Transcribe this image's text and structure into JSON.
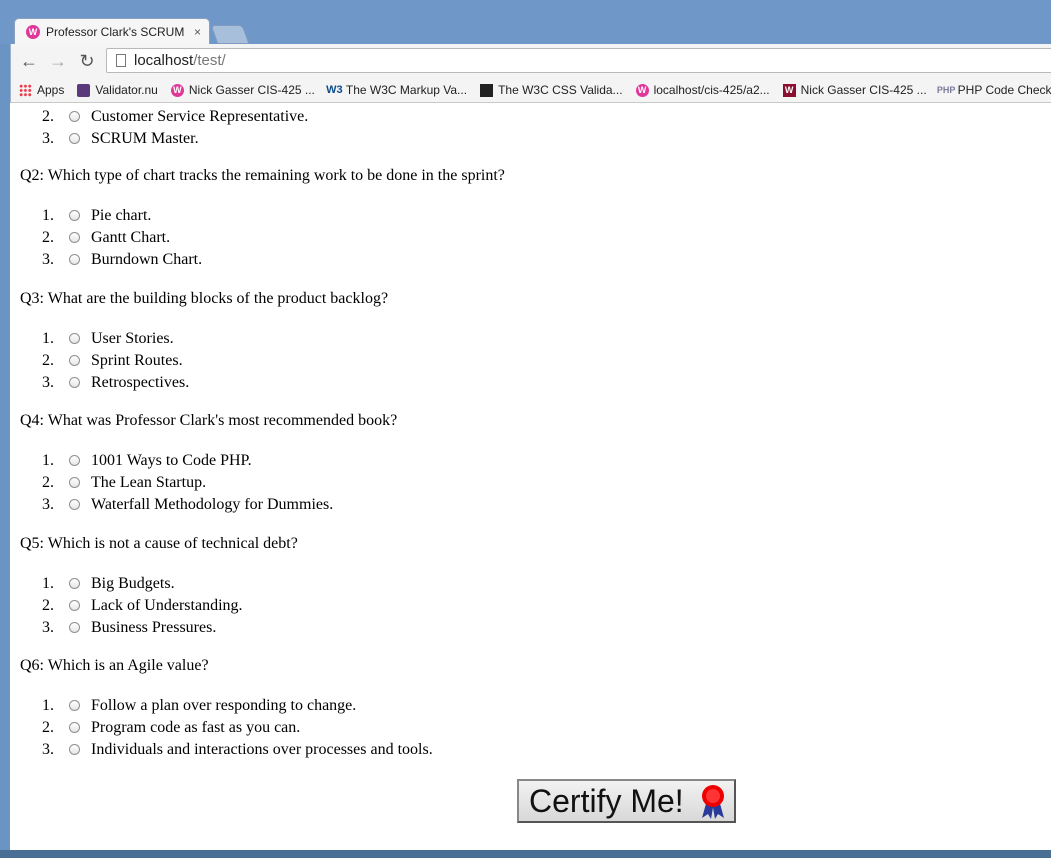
{
  "tab": {
    "title": "Professor Clark's SCRUM Q",
    "close": "×"
  },
  "toolbar": {
    "url_host": "localhost",
    "url_path": "/test/"
  },
  "bookmarks": [
    {
      "label": "Apps",
      "icon": "apps-grid-icon"
    },
    {
      "label": "Validator.nu",
      "icon": "validator-icon"
    },
    {
      "label": "Nick Gasser CIS-425 ...",
      "icon": "wamp-icon"
    },
    {
      "label": "The W3C Markup Va...",
      "icon": "w3c-icon"
    },
    {
      "label": "The W3C CSS Valida...",
      "icon": "css-validator-icon"
    },
    {
      "label": "localhost/cis-425/a2...",
      "icon": "wamp-icon"
    },
    {
      "label": "Nick Gasser CIS-425 ...",
      "icon": "w-icon"
    },
    {
      "label": "PHP Code Checker -",
      "icon": "php-icon"
    }
  ],
  "quiz": {
    "q1_partial_options": [
      {
        "num": "2.",
        "text": "Customer Service Representative."
      },
      {
        "num": "3.",
        "text": "SCRUM Master."
      }
    ],
    "questions": [
      {
        "text": "Q2: Which type of chart tracks the remaining work to be done in the sprint?",
        "options": [
          {
            "num": "1.",
            "text": "Pie chart."
          },
          {
            "num": "2.",
            "text": "Gantt Chart."
          },
          {
            "num": "3.",
            "text": "Burndown Chart."
          }
        ]
      },
      {
        "text": "Q3: What are the building blocks of the product backlog?",
        "options": [
          {
            "num": "1.",
            "text": "User Stories."
          },
          {
            "num": "2.",
            "text": "Sprint Routes."
          },
          {
            "num": "3.",
            "text": "Retrospectives."
          }
        ]
      },
      {
        "text": "Q4: What was Professor Clark's most recommended book?",
        "options": [
          {
            "num": "1.",
            "text": "1001 Ways to Code PHP."
          },
          {
            "num": "2.",
            "text": "The Lean Startup."
          },
          {
            "num": "3.",
            "text": "Waterfall Methodology for Dummies."
          }
        ]
      },
      {
        "text": "Q5: Which is not a cause of technical debt?",
        "options": [
          {
            "num": "1.",
            "text": "Big Budgets."
          },
          {
            "num": "2.",
            "text": "Lack of Understanding."
          },
          {
            "num": "3.",
            "text": "Business Pressures."
          }
        ]
      },
      {
        "text": "Q6: Which is an Agile value?",
        "options": [
          {
            "num": "1.",
            "text": "Follow a plan over responding to change."
          },
          {
            "num": "2.",
            "text": "Program code as fast as you can."
          },
          {
            "num": "3.",
            "text": "Individuals and interactions over processes and tools."
          }
        ]
      }
    ],
    "submit_label": "Certify Me!"
  }
}
